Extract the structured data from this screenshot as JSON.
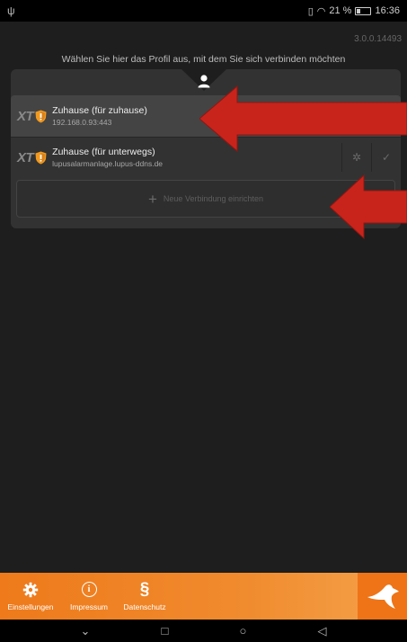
{
  "status_bar": {
    "battery_percent": "21 %",
    "time": "16:36"
  },
  "version": "3.0.0.14493",
  "hint": "Wählen Sie hier das Profil aus, mit dem Sie sich verbinden möchten",
  "profiles": [
    {
      "badge": "XT",
      "title": "Zuhause (für zuhause)",
      "address": "192.168.0.93:443",
      "icon": "shield-icon"
    },
    {
      "badge": "XT",
      "title": "Zuhause (für unterwegs)",
      "address": "lupusalarmanlage.lupus-ddns.de",
      "icon": "shield-icon"
    }
  ],
  "new_connection": "Neue Verbindung einrichten",
  "bottom_nav": {
    "settings": "Einstellungen",
    "impressum": "Impressum",
    "privacy": "Datenschutz"
  },
  "colors": {
    "accent": "#ee7a1b",
    "arrow": "#c8241c",
    "background": "#1e1e1e"
  }
}
